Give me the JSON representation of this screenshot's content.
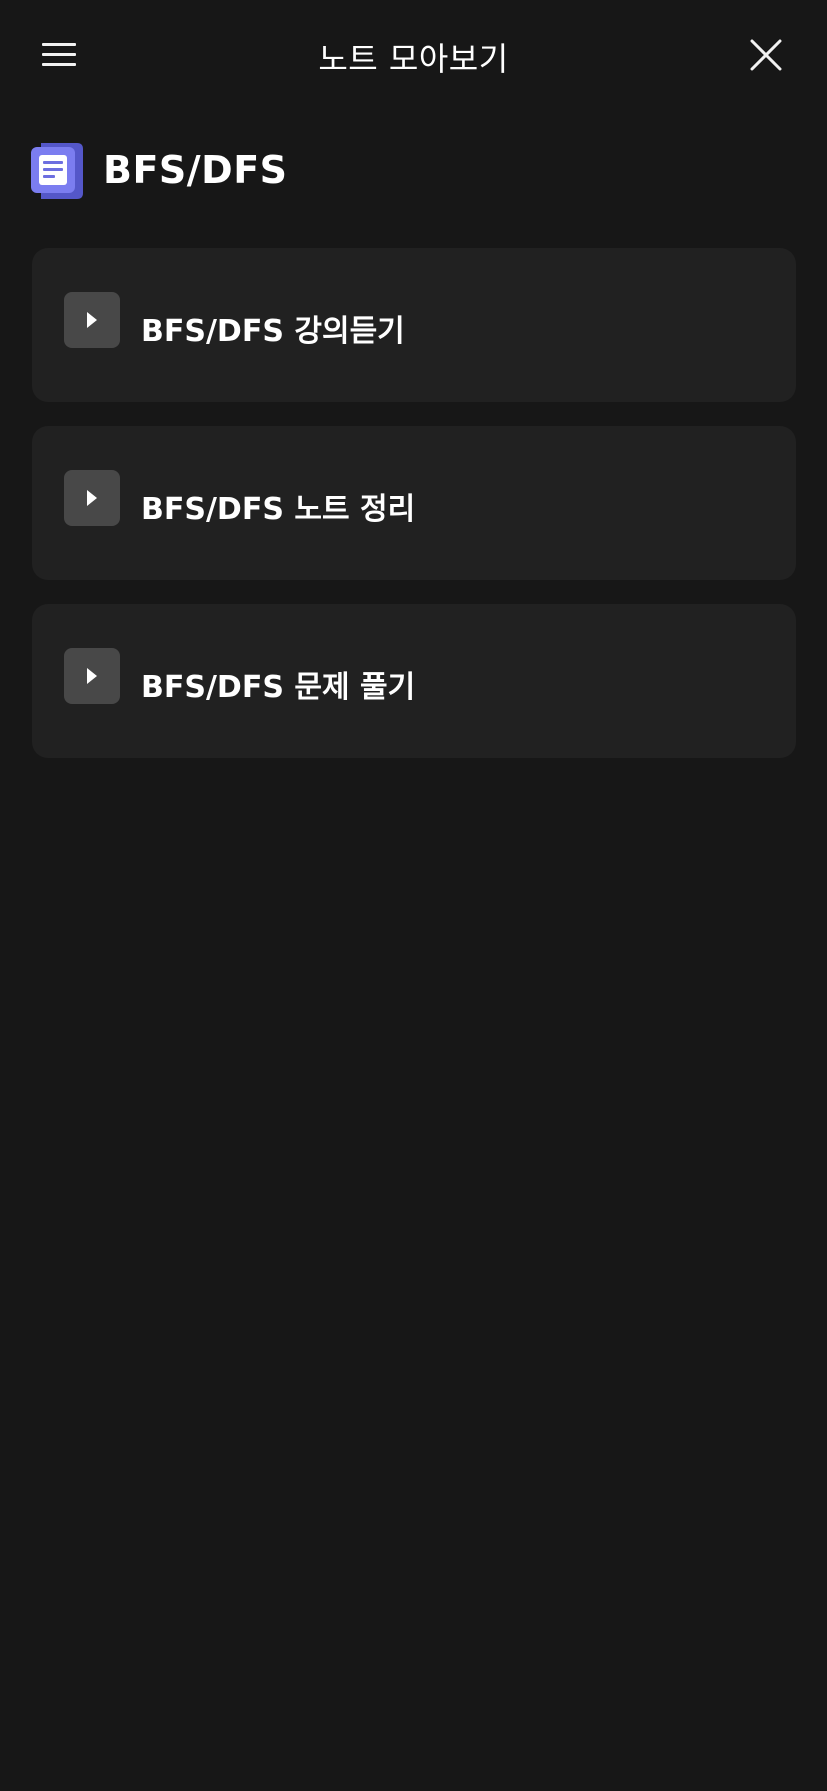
{
  "header": {
    "menu_icon": "hamburger-menu-icon",
    "title": "노트 모아보기",
    "close_icon": "close-icon"
  },
  "section": {
    "icon": "note-icon",
    "icon_color": "#6D6FE0",
    "title": "BFS/DFS"
  },
  "items": [
    {
      "icon": "play-icon",
      "label": "BFS/DFS 강의듣기"
    },
    {
      "icon": "play-icon",
      "label": "BFS/DFS 노트 정리"
    },
    {
      "icon": "play-icon",
      "label": "BFS/DFS 문제 풀기"
    }
  ],
  "colors": {
    "background": "#171717",
    "card": "#212121",
    "play_box": "#484848",
    "text": "#FFFFFF"
  }
}
